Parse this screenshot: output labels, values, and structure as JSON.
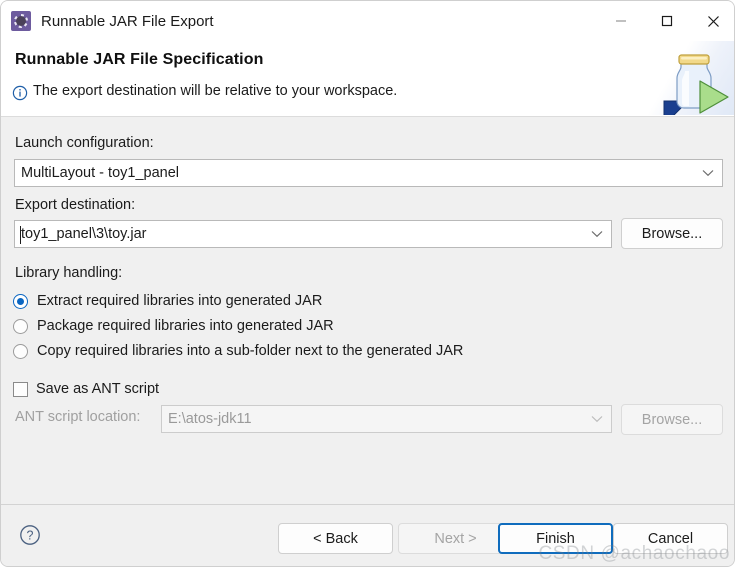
{
  "window": {
    "title": "Runnable JAR File Export",
    "app_icon": "eclipse-export-icon",
    "controls": {
      "minimize": "minimize-icon",
      "maximize": "maximize-icon",
      "close": "close-icon"
    }
  },
  "header": {
    "title": "Runnable JAR File Specification",
    "message": "The export destination will be relative to your workspace.",
    "message_icon": "info-icon",
    "banner_icon": "jar-export-banner-icon"
  },
  "form": {
    "launch_configuration": {
      "label": "Launch configuration:",
      "value": "MultiLayout - toy1_panel"
    },
    "export_destination": {
      "label": "Export destination:",
      "value": "toy1_panel\\3\\toy.jar",
      "browse_label": "Browse..."
    },
    "library_handling": {
      "label": "Library handling:",
      "options": [
        {
          "label": "Extract required libraries into generated JAR",
          "checked": true
        },
        {
          "label": "Package required libraries into generated JAR",
          "checked": false
        },
        {
          "label": "Copy required libraries into a sub-folder next to the generated JAR",
          "checked": false
        }
      ]
    },
    "save_as_ant": {
      "label": "Save as ANT script",
      "checked": false
    },
    "ant_script_location": {
      "label": "ANT script location:",
      "value": "E:\\atos-jdk11",
      "browse_label": "Browse...",
      "disabled": true
    }
  },
  "footer": {
    "help_icon": "help-icon",
    "buttons": [
      {
        "label": "< Back",
        "state": "enabled"
      },
      {
        "label": "Next >",
        "state": "disabled"
      },
      {
        "label": "Finish",
        "state": "default"
      },
      {
        "label": "Cancel",
        "state": "enabled"
      }
    ]
  },
  "watermark": "CSDN @achaochaoo",
  "colors": {
    "accent": "#0a66c2",
    "default_button_border": "#0f6cbd",
    "dialog_background": "#f0f0f0",
    "header_background": "#ffffff"
  }
}
